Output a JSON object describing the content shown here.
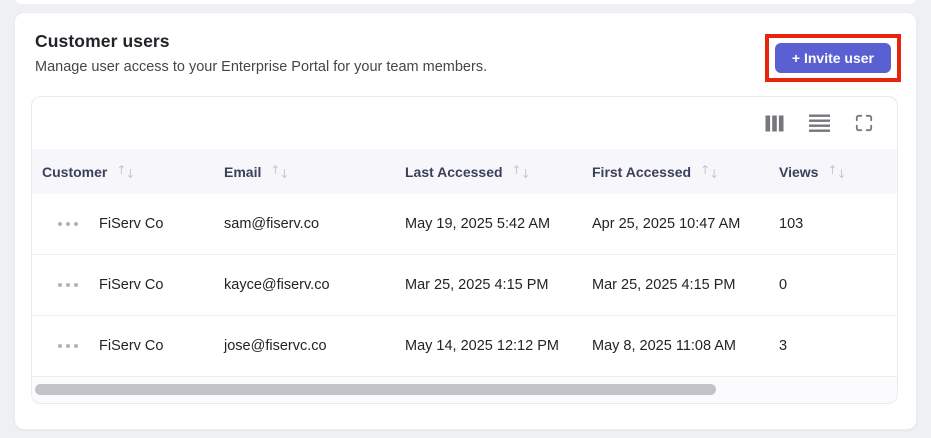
{
  "panel": {
    "title": "Customer users",
    "subtitle": "Manage user access to your Enterprise Portal for your team members.",
    "invite_button_label": "+ Invite user"
  },
  "toolbar": {
    "icons": [
      "columns-icon",
      "row-density-icon",
      "fullscreen-icon"
    ]
  },
  "table": {
    "columns": [
      {
        "label": "Customer",
        "sortable": true
      },
      {
        "label": "Email",
        "sortable": true
      },
      {
        "label": "Last Accessed",
        "sortable": true
      },
      {
        "label": "First Accessed",
        "sortable": true
      },
      {
        "label": "Views",
        "sortable": true
      }
    ],
    "sort_icon": {
      "up": "↑",
      "down": "↓"
    },
    "row_action_icon": "ellipsis-menu-icon",
    "rows": [
      {
        "customer": "FiServ Co",
        "email": "sam@fiserv.co",
        "last_accessed": "May 19, 2025 5:42 AM",
        "first_accessed": "Apr 25, 2025 10:47 AM",
        "views": "103"
      },
      {
        "customer": "FiServ Co",
        "email": "kayce@fiserv.co",
        "last_accessed": "Mar 25, 2025 4:15 PM",
        "first_accessed": "Mar 25, 2025 4:15 PM",
        "views": "0"
      },
      {
        "customer": "FiServ Co",
        "email": "jose@fiservc.co",
        "last_accessed": "May 14, 2025 12:12 PM",
        "first_accessed": "May 8, 2025 11:08 AM",
        "views": "3"
      }
    ]
  },
  "colors": {
    "accent": "#5a5fd2",
    "annotation_highlight": "#e8230e",
    "page_background": "#eef0f3",
    "header_row_background": "#f7f7fb",
    "header_text": "#3c3f5a"
  }
}
